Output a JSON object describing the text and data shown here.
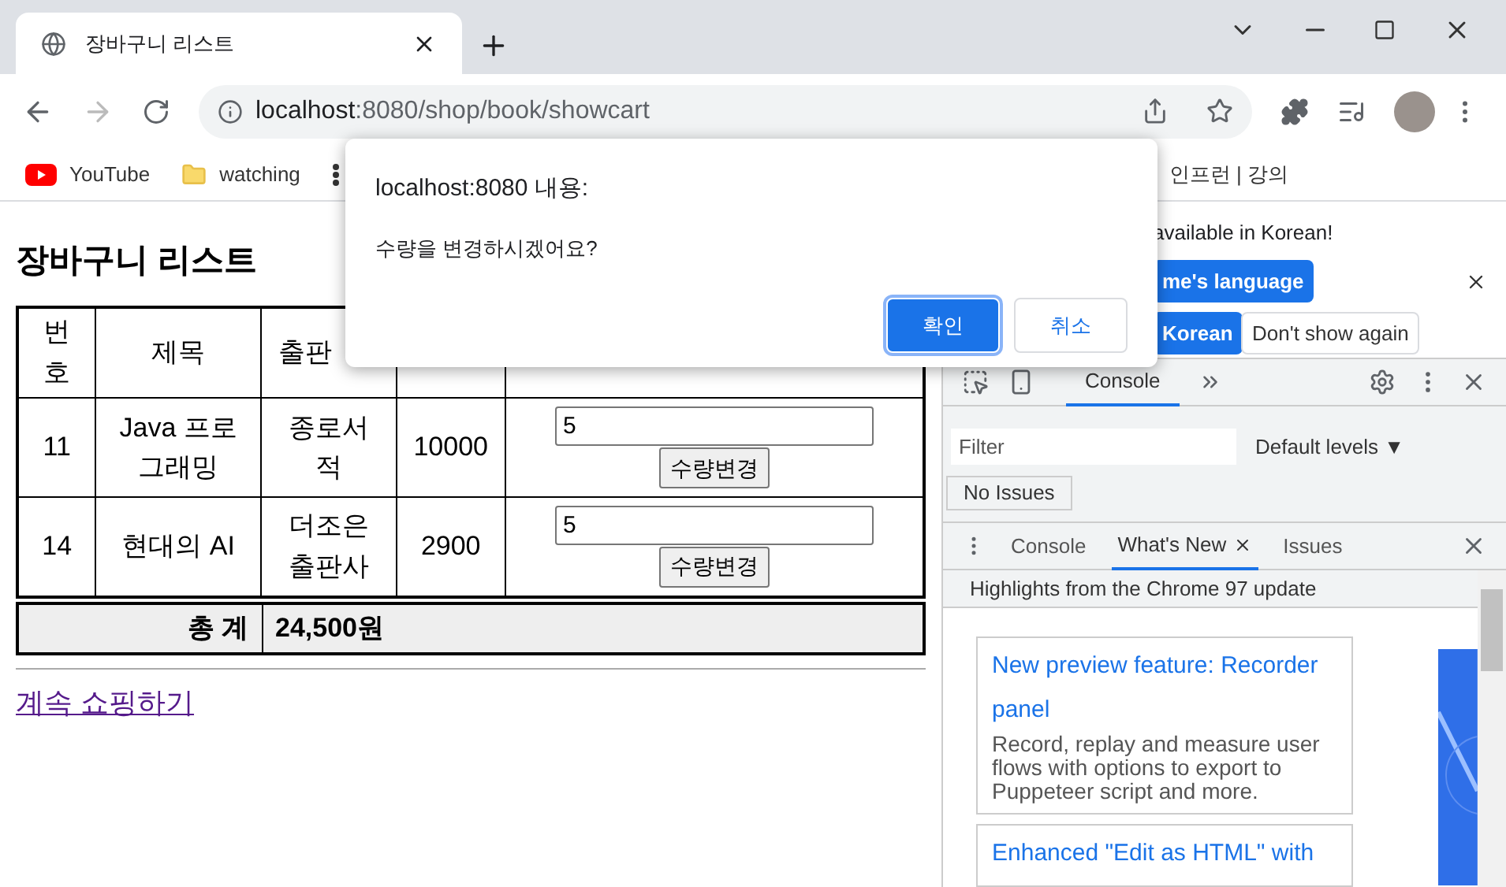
{
  "browser": {
    "tab_title": "장바구니 리스트",
    "url_host": "localhost",
    "url_rest": ":8080/shop/book/showcart",
    "bookmarks": [
      {
        "kind": "youtube",
        "label": "YouTube"
      },
      {
        "kind": "folder",
        "label": "watching"
      },
      {
        "kind": "apps"
      },
      {
        "kind": "text",
        "label": "인프런 | 강의"
      }
    ]
  },
  "page": {
    "heading": "장바구니 리스트",
    "columns": [
      "번호",
      "제목",
      "출판"
    ],
    "rows": [
      {
        "no": "11",
        "title": "Java 프로그래밍",
        "publisher": "종로서적",
        "price": "10000",
        "quantity": "5",
        "button": "수량변경"
      },
      {
        "no": "14",
        "title": "현대의 AI",
        "publisher": "더조은 출판사",
        "price": "2900",
        "quantity": "5",
        "button": "수량변경"
      }
    ],
    "total_label": "총 계",
    "total_value": "24,500원",
    "link": "계속 쇼핑하기"
  },
  "dialog": {
    "title": "localhost:8080 내용:",
    "message": "수량을 변경하시겠어요?",
    "buttons": [
      {
        "label": "확인",
        "primary": true
      },
      {
        "label": "취소",
        "primary": false
      }
    ]
  },
  "translate_bubble": {
    "message": "available in Korean!",
    "buttons": [
      {
        "label": "me's language",
        "primary": true
      },
      {
        "label": "Korean",
        "primary": true
      },
      {
        "label": "Don't show again",
        "primary": false
      }
    ]
  },
  "devtools": {
    "tabs": [
      {
        "label": "Console",
        "selected": true
      }
    ],
    "filter_placeholder": "Filter",
    "levels": "Default levels ▼",
    "issues": "No Issues",
    "drawer_tabs": [
      {
        "label": "Console",
        "selected": false,
        "closable": false
      },
      {
        "label": "What's New",
        "selected": true,
        "closable": true
      },
      {
        "label": "Issues",
        "selected": false,
        "closable": false
      }
    ],
    "highlights": "Highlights from the Chrome 97 update",
    "cards": [
      {
        "title": "New preview feature: Recorder panel",
        "body": "Record, replay and measure user flows with options to export to Puppeteer script and more."
      },
      {
        "title": "Enhanced \"Edit as HTML\" with"
      }
    ]
  }
}
